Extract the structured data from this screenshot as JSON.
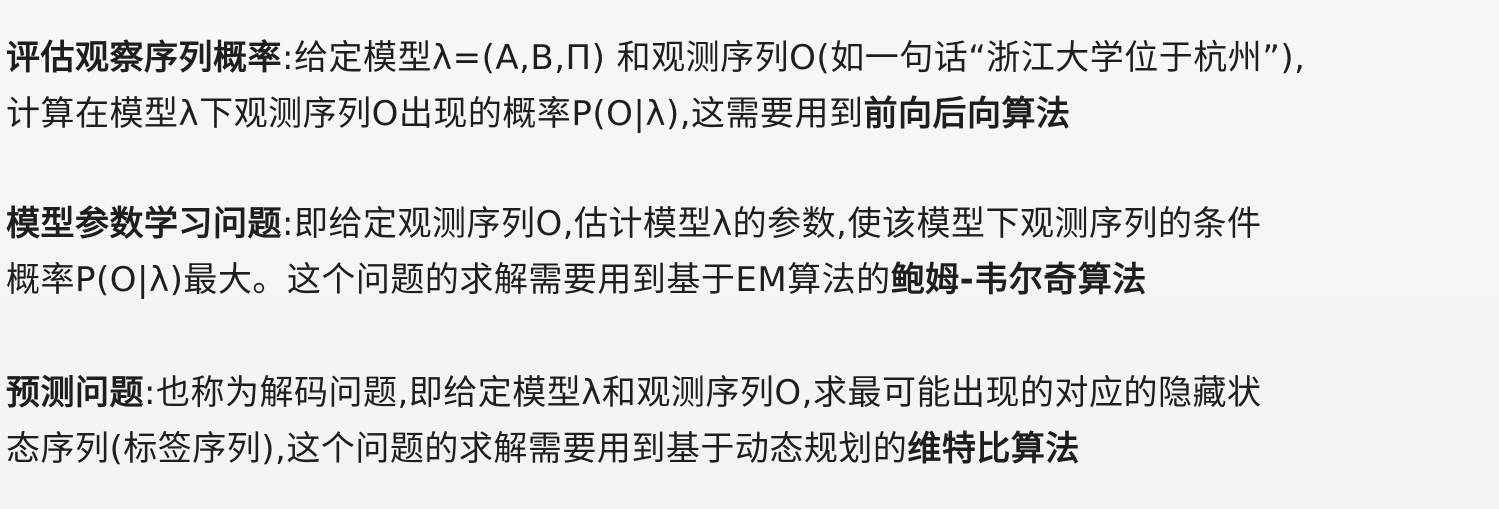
{
  "sections": [
    {
      "label": "评估观察序列概率",
      "line1_text": ":给定模型λ=(A,B,Π) 和观测序列O(如一句话“浙江大学位于杭州”),",
      "line2_text": "计算在模型λ下观测序列O出现的概率P(O|λ),这需要用到",
      "line2_bold": "前向后向算法"
    },
    {
      "label": "模型参数学习问题",
      "line1_text": ":即给定观测序列O,估计模型λ的参数,使该模型下观测序列的条件",
      "line2_text": "概率P(O|λ)最大。这个问题的求解需要用到基于EM算法的",
      "line2_bold": "鲍姆-韦尔奇算法"
    },
    {
      "label": "预测问题",
      "line1_text": ":也称为解码问题,即给定模型λ和观测序列O,求最可能出现的对应的隐藏状",
      "line2_text": "态序列(标签序列),这个问题的求解需要用到基于动态规划的",
      "line2_bold": "维特比算法"
    }
  ]
}
